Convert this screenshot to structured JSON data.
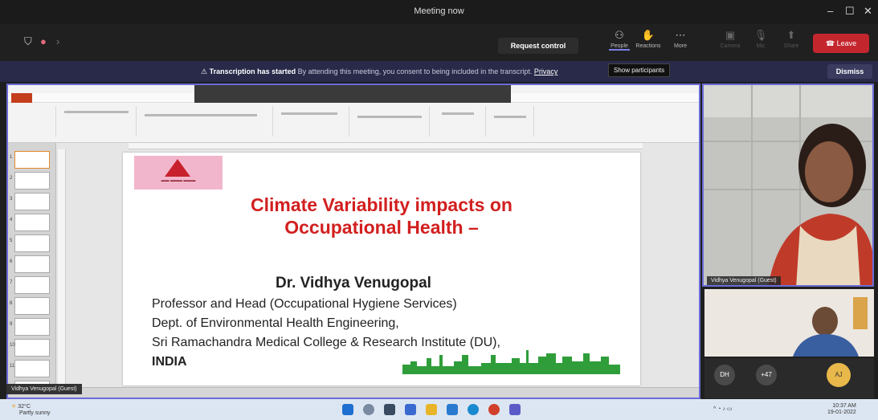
{
  "window": {
    "title": "Meeting now"
  },
  "toolbar": {
    "request_control": "Request control",
    "people_label": "People",
    "reactions_label": "Reactions",
    "more_label": "More",
    "camera_label": "Camera",
    "mic_label": "Mic",
    "share_label": "Share",
    "leave_label": "Leave"
  },
  "banner": {
    "strong": "Transcription has started",
    "message": "By attending this meeting, you consent to being included in the transcript.",
    "privacy": "Privacy",
    "tooltip": "Show participants",
    "dismiss": "Dismiss"
  },
  "slide": {
    "title_line1": "Climate Variability impacts on",
    "title_line2": "Occupational Health –",
    "author": "Dr. Vidhya Venugopal",
    "line1": "Professor and Head (Occupational Hygiene Services)",
    "line2": "Dept. of Environmental Health Engineering,",
    "line3": "Sri Ramachandra Medical College & Research Institute (DU),",
    "line4": "INDIA"
  },
  "presenter": {
    "name": "Vidhya Venugopal (Guest)"
  },
  "video1": {
    "name": "Vidhya Venugopal (Guest)"
  },
  "avatars": {
    "a1": "DH",
    "a2": "+47",
    "a3": "AJ"
  },
  "colors": {
    "accent": "#6b6bd8",
    "leave": "#c4262e",
    "slide_title": "#d21f1f",
    "banner": "#292a4a"
  },
  "taskbar": {
    "temp": "32°C",
    "weather": "Partly sunny",
    "time": "10:37 AM",
    "date": "19-01-2022"
  }
}
